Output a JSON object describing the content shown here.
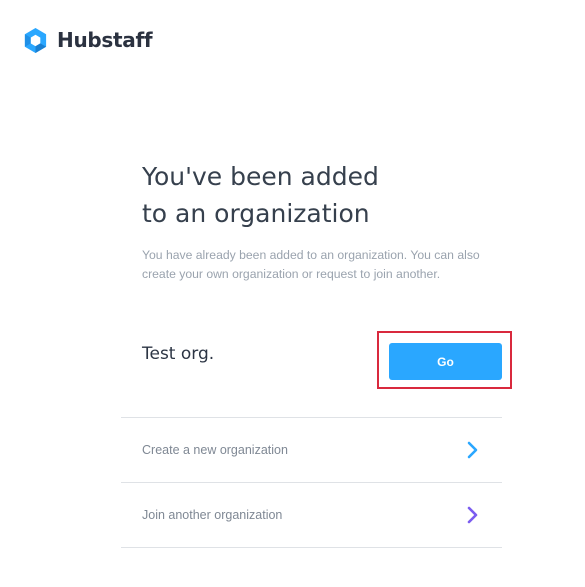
{
  "brand": {
    "name": "Hubstaff",
    "logo_icon": "hubstaff-logo-icon",
    "logo_color": "#2aa7ff"
  },
  "main": {
    "title_lines": [
      "You've been added",
      "to an organization"
    ],
    "description_lines": [
      "You have already been added to an organization. You can also",
      "create your own organization or request to join another."
    ],
    "organization": {
      "name": "Test org.",
      "go_label": "Go"
    },
    "options": [
      {
        "label": "Create a new organization",
        "icon": "chevron-right-icon",
        "color": "#2aa7ff"
      },
      {
        "label": "Join another organization",
        "icon": "chevron-right-icon",
        "color": "#7b5cf0"
      }
    ]
  },
  "colors": {
    "primary": "#2aa7ff",
    "highlight_border": "#d9293d",
    "join_accent": "#7b5cf0"
  }
}
